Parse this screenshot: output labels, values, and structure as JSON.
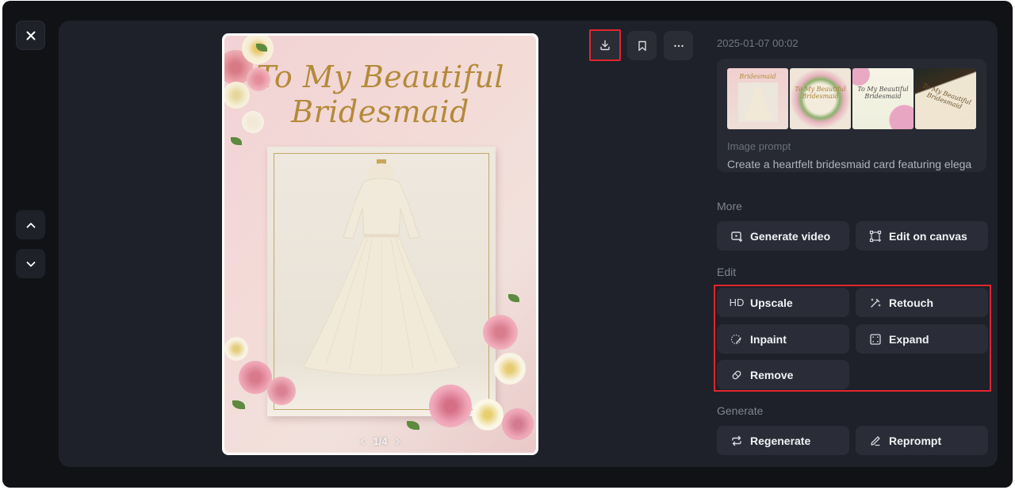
{
  "nav": {
    "close_icon": "close-icon",
    "prev_icon": "chevron-up-icon",
    "next_icon": "chevron-down-icon"
  },
  "image": {
    "title_line1": "To My Beautiful",
    "title_line2": "Bridesmaid",
    "pager": "1/4",
    "pager_prev": "‹",
    "pager_next": "›"
  },
  "actions": {
    "download_icon": "download-icon",
    "bookmark_icon": "bookmark-icon",
    "more_icon": "more-horizontal-icon"
  },
  "details": {
    "timestamp": "2025-01-07 00:02",
    "thumbnails": [
      {
        "caption": "Bridesmaid"
      },
      {
        "caption": "To My Beautiful Bridesmaid"
      },
      {
        "caption": "To My Beautiful Bridesmaid"
      },
      {
        "caption": "To My Beautiful Bridesmaid"
      }
    ],
    "prompt_label": "Image prompt",
    "prompt_text": "Create a heartfelt bridesmaid card featuring elega"
  },
  "sections": {
    "more": {
      "label": "More",
      "buttons": [
        {
          "label": "Generate video",
          "icon": "video-add-icon"
        },
        {
          "label": "Edit on canvas",
          "icon": "canvas-icon"
        }
      ]
    },
    "edit": {
      "label": "Edit",
      "buttons": [
        {
          "label": "Upscale",
          "icon": "hd-icon",
          "icon_text": "HD"
        },
        {
          "label": "Retouch",
          "icon": "magic-wand-icon"
        },
        {
          "label": "Inpaint",
          "icon": "inpaint-brush-icon"
        },
        {
          "label": "Expand",
          "icon": "expand-icon"
        },
        {
          "label": "Remove",
          "icon": "eraser-icon"
        }
      ]
    },
    "generate": {
      "label": "Generate",
      "buttons": [
        {
          "label": "Regenerate",
          "icon": "regenerate-icon"
        },
        {
          "label": "Reprompt",
          "icon": "pencil-icon"
        }
      ]
    }
  },
  "colors": {
    "highlight": "#e0262f",
    "panel": "#1e2129",
    "button": "#2a2d37"
  }
}
